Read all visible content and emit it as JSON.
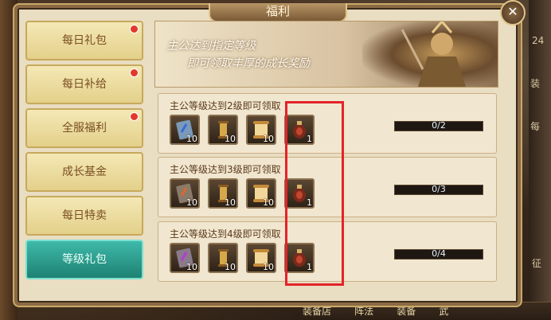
{
  "window": {
    "title": "福利"
  },
  "close_label": "✕",
  "tabs": [
    {
      "label": "每日礼包",
      "badge": true
    },
    {
      "label": "每日补给",
      "badge": true
    },
    {
      "label": "全服福利",
      "badge": true
    },
    {
      "label": "成长基金",
      "badge": false
    },
    {
      "label": "每日特卖",
      "badge": false
    },
    {
      "label": "等级礼包",
      "badge": false,
      "active": true
    }
  ],
  "banner": {
    "line1": "主公达到指定等级",
    "line2": "即可领取丰厚的成长奖励"
  },
  "rows": [
    {
      "title": "主公等级达到2级即可领取",
      "progress": "0/2",
      "items": [
        {
          "icon": "blue-card-icon",
          "count": "10"
        },
        {
          "icon": "scroll-icon",
          "count": "10"
        },
        {
          "icon": "paper-scroll-icon",
          "count": "10"
        },
        {
          "icon": "red-pouch-icon",
          "count": "1"
        }
      ]
    },
    {
      "title": "主公等级达到3级即可领取",
      "progress": "0/3",
      "items": [
        {
          "icon": "blue-card-icon",
          "count": "10"
        },
        {
          "icon": "scroll-icon",
          "count": "10"
        },
        {
          "icon": "paper-scroll-icon",
          "count": "10"
        },
        {
          "icon": "red-pouch-icon",
          "count": "1"
        }
      ]
    },
    {
      "title": "主公等级达到4级即可领取",
      "progress": "0/4",
      "items": [
        {
          "icon": "purple-card-icon",
          "count": "10"
        },
        {
          "icon": "scroll-icon",
          "count": "10"
        },
        {
          "icon": "paper-scroll-icon",
          "count": "10"
        },
        {
          "icon": "red-pouch-icon",
          "count": "1"
        }
      ]
    }
  ],
  "background": {
    "right_labels": [
      "24",
      "装",
      "每",
      "征"
    ],
    "bottom_bar": [
      "装备店",
      "阵法",
      "装备",
      "武"
    ]
  },
  "colors": {
    "active_tab": "#2a9d8f",
    "highlight_box": "#e3232a",
    "badge": "#e2372c"
  }
}
